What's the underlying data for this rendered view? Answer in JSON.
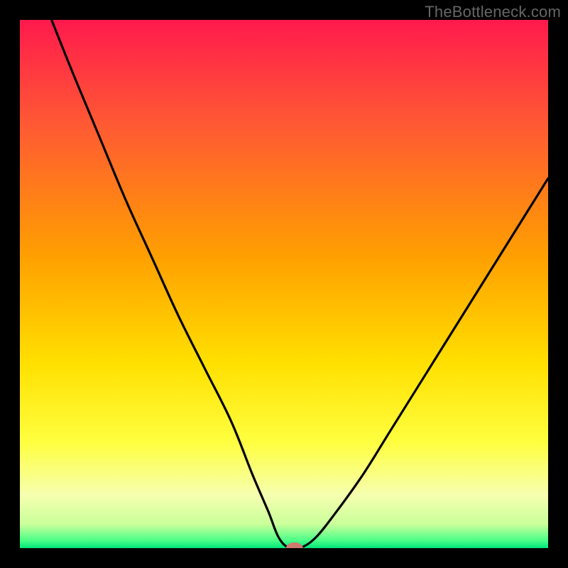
{
  "watermark": "TheBottleneck.com",
  "colors": {
    "frame": "#000000",
    "watermark_text": "#666666",
    "curve": "#000000",
    "marker_fill": "#cf7b70",
    "gradient_stops": [
      {
        "offset": 0.0,
        "color": "#ff1a4d"
      },
      {
        "offset": 0.2,
        "color": "#ff5a33"
      },
      {
        "offset": 0.45,
        "color": "#ffa000"
      },
      {
        "offset": 0.65,
        "color": "#ffe000"
      },
      {
        "offset": 0.8,
        "color": "#ffff40"
      },
      {
        "offset": 0.9,
        "color": "#f6ffb0"
      },
      {
        "offset": 0.955,
        "color": "#c9ff9a"
      },
      {
        "offset": 0.985,
        "color": "#4dff88"
      },
      {
        "offset": 1.0,
        "color": "#00e57a"
      }
    ]
  },
  "chart_data": {
    "type": "line",
    "title": "",
    "xlabel": "",
    "ylabel": "",
    "xlim": [
      0,
      100
    ],
    "ylim": [
      0,
      100
    ],
    "series": [
      {
        "name": "bottleneck-curve",
        "x": [
          6,
          10,
          15,
          20,
          25,
          30,
          35,
          40,
          44,
          47,
          49,
          51,
          53,
          56,
          60,
          65,
          70,
          75,
          80,
          85,
          90,
          95,
          100
        ],
        "y": [
          100,
          90,
          78,
          66,
          55,
          44,
          34,
          24,
          14,
          7,
          2,
          0,
          0,
          2,
          7,
          14,
          22,
          30,
          38,
          46,
          54,
          62,
          70
        ]
      }
    ],
    "marker": {
      "x": 52,
      "y": 0,
      "rx": 1.6,
      "ry": 1.1
    },
    "annotations": []
  }
}
